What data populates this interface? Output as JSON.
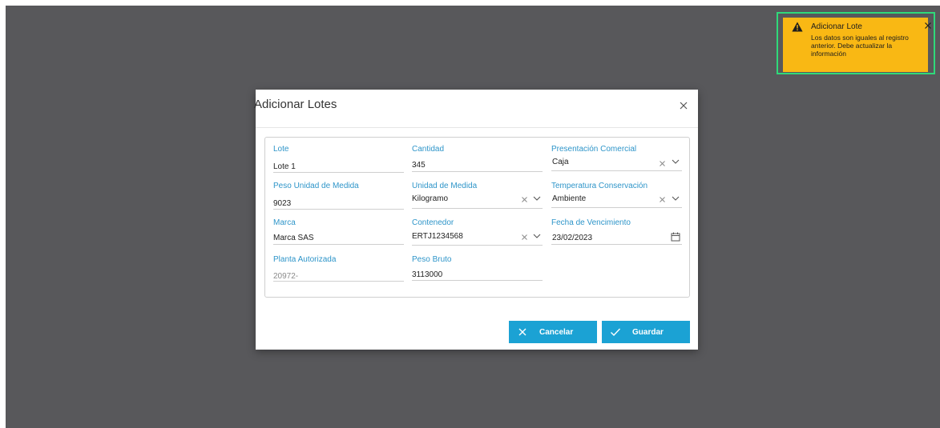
{
  "modal": {
    "title": "Adicionar Lotes",
    "fields": {
      "lote": {
        "label": "Lote",
        "value": "Lote 1"
      },
      "cantidad": {
        "label": "Cantidad",
        "value": "345"
      },
      "presentacion": {
        "label": "Presentación Comercial",
        "value": "Caja"
      },
      "peso_unidad": {
        "label": "Peso Unidad de Medida",
        "value": "9023"
      },
      "unidad_medida": {
        "label": "Unidad de Medida",
        "value": "Kilogramo"
      },
      "temperatura": {
        "label": "Temperatura Conservación",
        "value": "Ambiente"
      },
      "marca": {
        "label": "Marca",
        "value": "Marca SAS"
      },
      "contenedor": {
        "label": "Contenedor",
        "value": "ERTJ1234568"
      },
      "fecha_vencimiento": {
        "label": "Fecha de Vencimiento",
        "value": "23/02/2023"
      },
      "planta": {
        "label": "Planta Autorizada",
        "value": "20972-"
      },
      "peso_bruto": {
        "label": "Peso Bruto",
        "value": "3113000"
      }
    },
    "buttons": {
      "cancel": "Cancelar",
      "save": "Guardar"
    }
  },
  "toast": {
    "title": "Adicionar Lote",
    "message": "Los datos son iguales al registro anterior. Debe actualizar la información"
  },
  "colors": {
    "accent": "#1ba2d4",
    "label": "#2e95c9",
    "warning": "#f9b814",
    "overlay": "#58585b"
  }
}
